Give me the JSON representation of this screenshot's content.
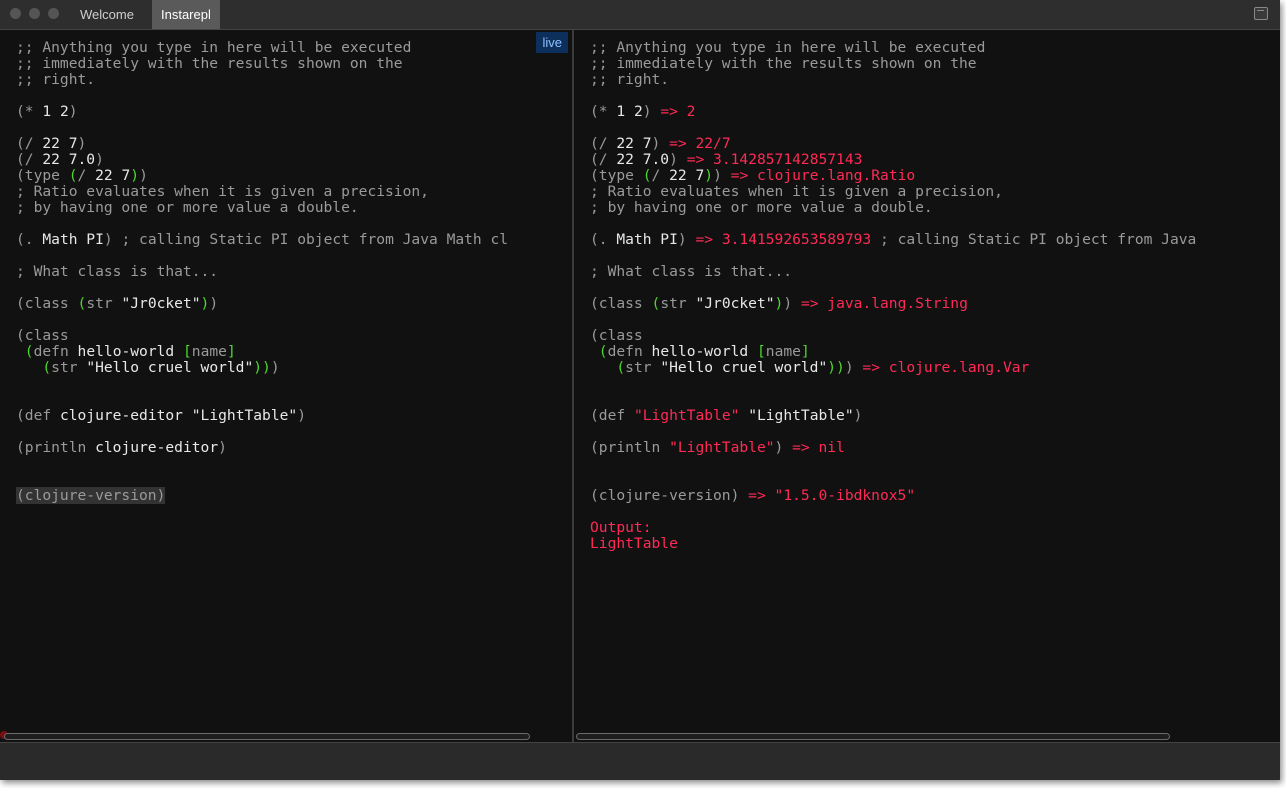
{
  "tabs": [
    {
      "label": "Welcome",
      "active": false
    },
    {
      "label": "Instarepl",
      "active": true
    }
  ],
  "live_badge": "live",
  "colors": {
    "background": "#111111",
    "comment": "#9a9a9a",
    "literal": "#e8e8e8",
    "bracket_green": "#4dd830",
    "result_red": "#ff2a55",
    "live_badge_bg": "#0d2f5c"
  },
  "editor_lines": [
    ";; Anything you type in here will be executed",
    ";; immediately with the results shown on the",
    ";; right.",
    "(* 1 2)",
    "(/ 22 7)",
    "(/ 22 7.0)",
    "(type (/ 22 7))",
    "; Ratio evaluates when it is given a precision,",
    "; by having one or more value a double.",
    "(. Math PI) ; calling Static PI object from Java Math cl",
    "; What class is that...",
    "(class (str \"Jr0cket\"))",
    "(class",
    " (defn hello-world [name]",
    "   (str \"Hello cruel world\")))",
    "(def clojure-editor \"LightTable\")",
    "(println clojure-editor)",
    "(clojure-version)"
  ],
  "results": {
    "mul": "=> 2",
    "div": "=> 22/7",
    "div_float": "=> 3.142857142857143",
    "type": "=> clojure.lang.Ratio",
    "pi": "=> 3.141592653589793",
    "pi_comment": "; calling Static PI object from Java",
    "class_str": "=> java.lang.String",
    "class_var": "=> clojure.lang.Var",
    "def_value": "\"LightTable\"",
    "println_arg": "\"LightTable\"",
    "println_result": "=> nil",
    "version": "=> \"1.5.0-ibdknox5\"",
    "output_label": "Output:",
    "output_value": "LightTable"
  }
}
